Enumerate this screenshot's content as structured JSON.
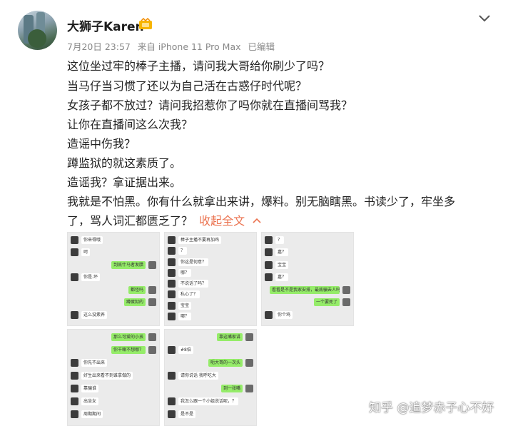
{
  "user": {
    "name": "大狮子Karen"
  },
  "icons": {
    "badge": "vip-badge-icon",
    "more": "chevron-down-icon"
  },
  "meta": {
    "date": "7月20日 23:57",
    "source": "来自 iPhone 11 Pro Max",
    "edited": "已编辑"
  },
  "post": {
    "lines": [
      "这位坐过牢的棒子主播，请问我大哥给你刷少了吗？",
      "当马仔当习惯了还以为自己活在古惑仔时代呢？",
      "女孩子都不放过？请问我招惹你了吗你就在直播间骂我？",
      "让你在直播间这么次我？",
      "造谣中伤我？",
      "蹲监狱的就这素质了。",
      "造谣我？拿证据出来。",
      "我就是不怕黑。你有什么就拿出来讲，爆料。别无脑瞎黑。书读少了，牢坐多",
      "了，骂人词汇都匮乏了？"
    ],
    "collapse_label": "收起全文"
  },
  "colors": {
    "link": "#eb7350",
    "bubble_sent": "#95ec69",
    "chat_bg": "#ebebeb"
  },
  "screenshots": [
    [
      {
        "side": "l",
        "text": "你来得哦"
      },
      {
        "side": "l",
        "text": "呵"
      },
      {
        "side": "r",
        "text": "到底什马者发腊"
      },
      {
        "side": "l",
        "text": "你是.坏"
      },
      {
        "side": "r",
        "text": "都怪吗"
      },
      {
        "side": "r",
        "text": "蹲蛋狱的"
      },
      {
        "side": "l",
        "text": "这么没素养"
      }
    ],
    [
      {
        "side": "l",
        "text": "棒子主播不要再加鸡"
      },
      {
        "side": "l",
        "text": "？"
      },
      {
        "side": "l",
        "text": "你这是何意？"
      },
      {
        "side": "l",
        "text": "哪？"
      },
      {
        "side": "l",
        "text": "不说话了吗？"
      },
      {
        "side": "l",
        "text": "私心了？"
      },
      {
        "side": "l",
        "text": "宝宝"
      },
      {
        "side": "l",
        "text": "哪？"
      }
    ],
    [
      {
        "side": "l",
        "text": "？"
      },
      {
        "side": "l",
        "text": "嘉？"
      },
      {
        "side": "l",
        "text": "宝宝"
      },
      {
        "side": "l",
        "text": "嘉？"
      },
      {
        "side": "r",
        "text": "看看是不是我家安排，最底骗去人吗。"
      },
      {
        "side": "r",
        "text": "一个要死了"
      },
      {
        "side": "l",
        "text": "你个鸡"
      }
    ],
    [
      {
        "side": "r",
        "text": "那么可爱的小孩"
      },
      {
        "side": "r",
        "text": "你干嘛不想哪？"
      },
      {
        "side": "l",
        "text": "你先不出来"
      },
      {
        "side": "l",
        "text": "好生出来看不到谁拿做的"
      },
      {
        "side": "l",
        "text": "靠骗谁"
      },
      {
        "side": "l",
        "text": "出坐女"
      },
      {
        "side": "l",
        "text": "周期期间"
      }
    ],
    [
      {
        "side": "r",
        "text": "靠这嘴家讲"
      },
      {
        "side": "l",
        "text": "#8倍"
      },
      {
        "side": "r",
        "text": "呃大哥的一次头"
      },
      {
        "side": "l",
        "text": "请你说话 我呼吃大"
      },
      {
        "side": "r",
        "text": "到一张嘴"
      },
      {
        "side": "l",
        "text": "我怎么跟一个小姐说话呢，？"
      },
      {
        "side": "l",
        "text": "是不是"
      }
    ]
  ],
  "watermark": "知乎 @追梦赤子心不好"
}
